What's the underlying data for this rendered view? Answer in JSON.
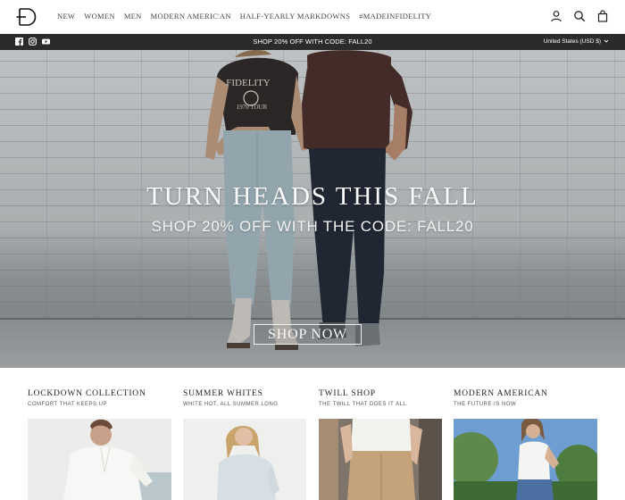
{
  "header": {
    "nav": [
      "NEW",
      "WOMEN",
      "MEN",
      "MODERN AMERIC'AN",
      "HALF-YEARLY MARKDOWNS",
      "#MADEINFIDELITY"
    ]
  },
  "announcement": {
    "text": "SHOP 20% OFF WITH CODE: FALL20",
    "currency": "United States (USD $)"
  },
  "hero": {
    "title": "TURN HEADS THIS FALL",
    "subtitle": "SHOP 20% OFF WITH THE CODE: FALL20",
    "button": "SHOP NOW",
    "shirt_text_line1": "FIDELITY",
    "shirt_text_line2": "1970 TOUR"
  },
  "collections": [
    {
      "title": "LOCKDOWN COLLECTION",
      "subtitle": "COMFORT THAT KEEPS UP"
    },
    {
      "title": "SUMMER WHITES",
      "subtitle": "WHITE HOT, ALL SUMMER LONG"
    },
    {
      "title": "TWILL SHOP",
      "subtitle": "THE TWILL THAT DOES IT ALL"
    },
    {
      "title": "MODERN AMERICAN",
      "subtitle": "THE FUTURE IS NOW"
    }
  ],
  "icons": {
    "logo": "fidelity-logo",
    "account": "account-icon",
    "search": "search-icon",
    "cart": "cart-icon",
    "facebook": "facebook-icon",
    "instagram": "instagram-icon",
    "youtube": "youtube-icon"
  },
  "colors": {
    "announcement_bg": "#2b2b2b",
    "text": "#222222"
  }
}
